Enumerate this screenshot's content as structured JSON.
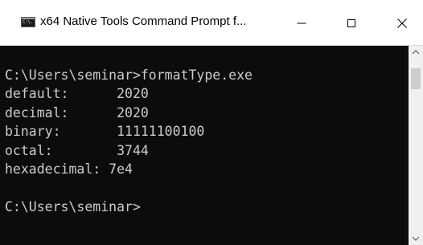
{
  "window": {
    "title": "x64 Native Tools Command Prompt f...",
    "icon_label": "C:\\."
  },
  "console": {
    "lines": [
      "",
      "C:\\Users\\seminar>formatType.exe",
      "default:      2020",
      "decimal:      2020",
      "binary:       11111100100",
      "octal:        3744",
      "hexadecimal: 7e4",
      "",
      "C:\\Users\\seminar>"
    ]
  },
  "colors": {
    "console_background": "#0c0c0c",
    "console_text": "#cccccc",
    "titlebar_background": "#ffffff",
    "scrollbar_track": "#f0f0f0",
    "scrollbar_thumb": "#cdcdcd"
  },
  "icons": {
    "app": "console-app-icon",
    "minimize": "minimize-icon",
    "maximize": "maximize-icon",
    "close": "close-icon",
    "scroll_up": "chevron-up-icon",
    "scroll_down": "chevron-down-icon"
  }
}
